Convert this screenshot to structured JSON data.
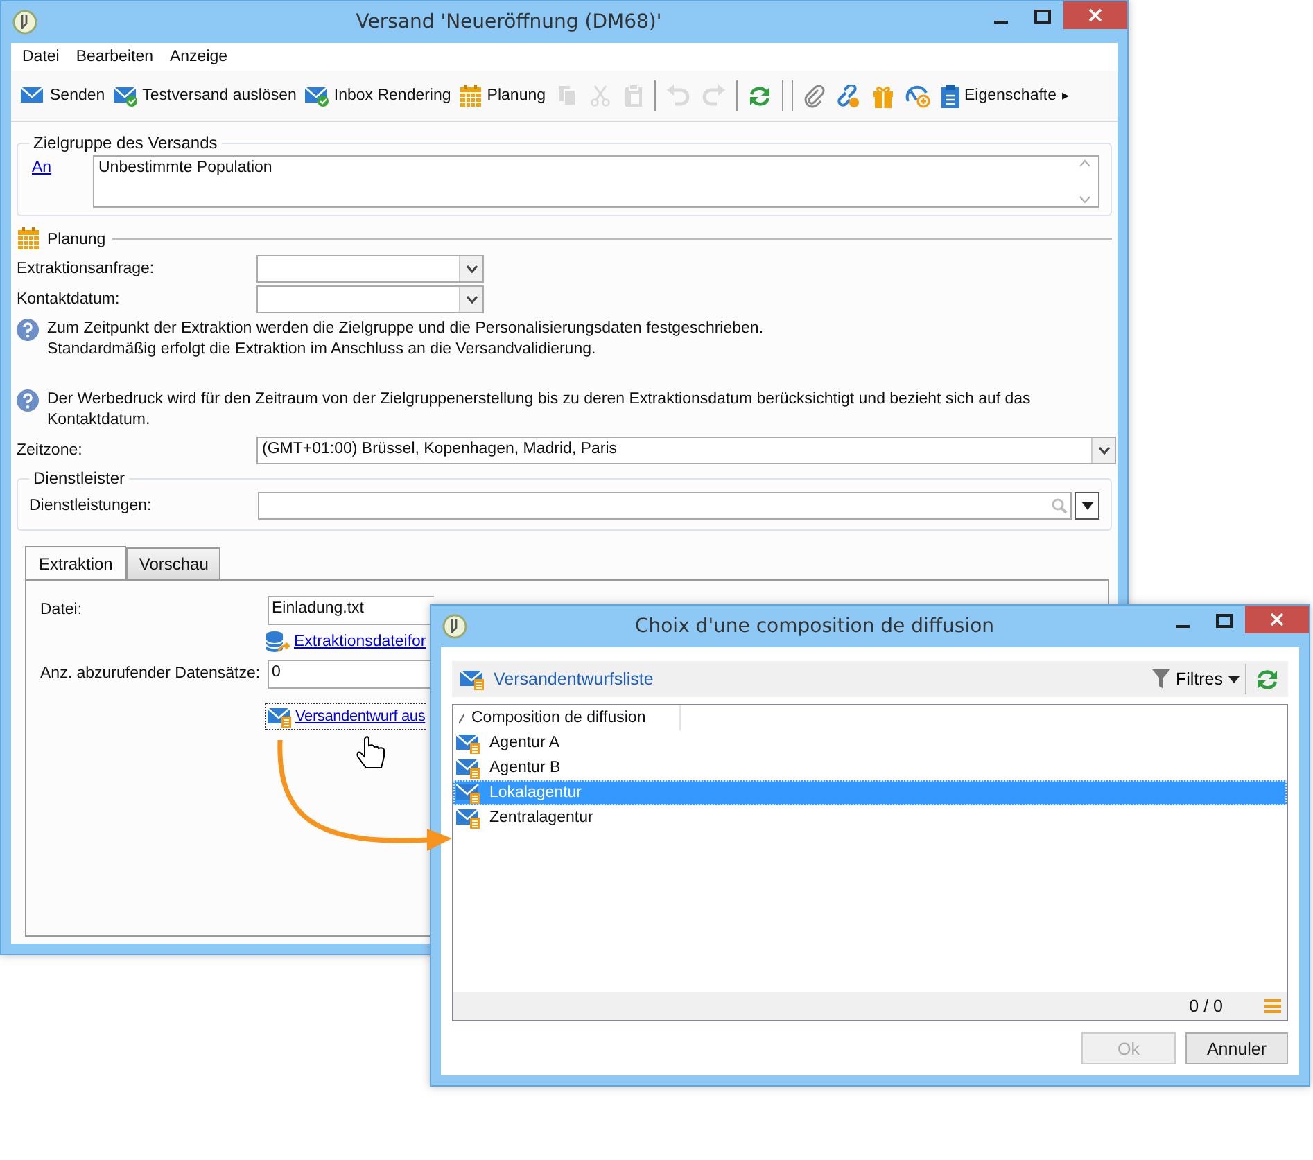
{
  "main_window": {
    "title": "Versand 'Neueröffnung (DM68)'",
    "menu": [
      "Datei",
      "Bearbeiten",
      "Anzeige"
    ],
    "toolbar": [
      {
        "kind": "button",
        "label": "Senden",
        "disabled": false
      },
      {
        "kind": "button",
        "label": "Testversand auslösen",
        "disabled": false
      },
      {
        "kind": "button",
        "label": "Inbox Rendering",
        "disabled": false
      },
      {
        "kind": "button",
        "label": "Planung",
        "disabled": false
      },
      {
        "kind": "icon",
        "disabled": true
      },
      {
        "kind": "icon",
        "disabled": true
      },
      {
        "kind": "icon",
        "disabled": true
      },
      {
        "kind": "separator"
      },
      {
        "kind": "icon",
        "disabled": true
      },
      {
        "kind": "icon",
        "disabled": true
      },
      {
        "kind": "separator"
      },
      {
        "kind": "icon",
        "disabled": false
      },
      {
        "kind": "separator"
      },
      {
        "kind": "separator"
      },
      {
        "kind": "icon",
        "disabled": false
      },
      {
        "kind": "icon",
        "disabled": false
      },
      {
        "kind": "icon",
        "disabled": false
      },
      {
        "kind": "icon",
        "disabled": false
      },
      {
        "kind": "button",
        "label": "Eigenschafte",
        "disabled": false
      },
      {
        "kind": "more",
        "label": "▸"
      }
    ],
    "target": {
      "title": "Zielgruppe des Versands",
      "link": "An",
      "value": "Unbestimmte Population"
    },
    "planning": {
      "title": "Planung",
      "fields": [
        {
          "label": "Extraktionsanfrage:"
        },
        {
          "label": "Kontaktdatum:"
        }
      ],
      "notes": [
        {
          "lines": [
            "Zum Zeitpunkt der Extraktion werden die Zielgruppe und die Personalisierungsdaten festgeschrieben.",
            "Standardmäßig erfolgt die Extraktion im Anschluss an die Versandvalidierung."
          ]
        },
        {
          "lines": [
            "Der Werbedruck wird für den Zeitraum von der Zielgruppenerstellung bis zu deren Extraktionsdatum berücksichtigt und bezieht sich auf das",
            "Kontaktdatum."
          ]
        }
      ],
      "timezone": {
        "label": "Zeitzone:",
        "value": "(GMT+01:00) Brüssel, Kopenhagen, Madrid, Paris"
      },
      "provider": {
        "title": "Dienstleister",
        "label": "Dienstleistungen:"
      }
    },
    "tabs": [
      {
        "label": "Extraktion",
        "selected": true
      },
      {
        "label": "Vorschau",
        "selected": false
      }
    ],
    "extraction": {
      "file_label": "Datei:",
      "file_value": "Einladung.txt",
      "format_link": "Extraktionsdateifor",
      "count_label": "Anz. abzurufender Datensätze:",
      "count_value": "0",
      "draft_link": "Versandentwurf aus"
    }
  },
  "dialog": {
    "title": "Choix d'une composition de diffusion",
    "list_title": "Versandentwurfsliste",
    "filter": "Filtres",
    "column": "Composition de diffusion",
    "rows": [
      {
        "label": "Agentur A",
        "selected": false
      },
      {
        "label": "Agentur B",
        "selected": false
      },
      {
        "label": "Lokalagentur",
        "selected": true
      },
      {
        "label": "Zentralagentur",
        "selected": false
      }
    ],
    "counter": "0 / 0",
    "buttons": [
      {
        "label": "Ok",
        "disabled": true
      },
      {
        "label": "Annuler",
        "disabled": false
      }
    ]
  }
}
